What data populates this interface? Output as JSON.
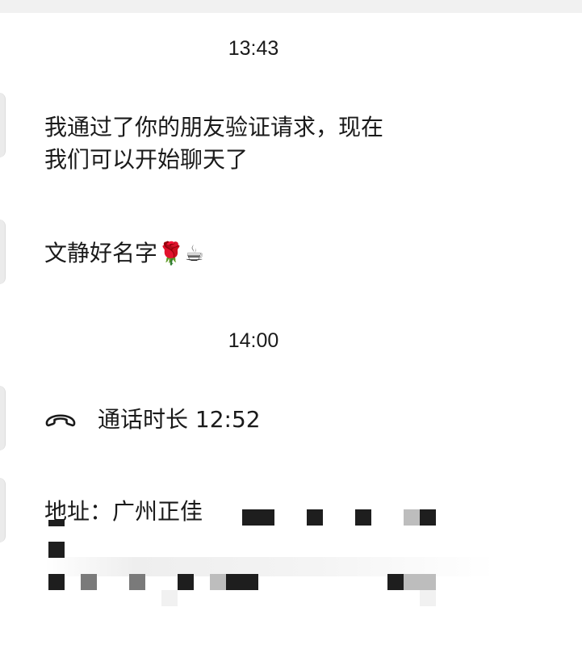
{
  "chat": {
    "timestamp_1": "13:43",
    "timestamp_2": "14:00",
    "messages": [
      {
        "line_1": "我通过了你的朋友验证请求，现在",
        "line_2": "我们可以开始聊天了"
      },
      {
        "text": "文静好名字",
        "emoji_1": "🌹",
        "emoji_2": "☕"
      },
      {
        "call_text": "通话时长 12:52",
        "icon": "phone-hangup-icon"
      },
      {
        "text": "地址：广州正佳"
      }
    ]
  },
  "colors": {
    "background": "#ffffff",
    "text": "#1a1a1a",
    "avatar_edge": "#ebebeb",
    "redaction_dark": "#1e1e1e",
    "redaction_mid": "#7a7a7a",
    "redaction_light": "#bdbdbd"
  }
}
